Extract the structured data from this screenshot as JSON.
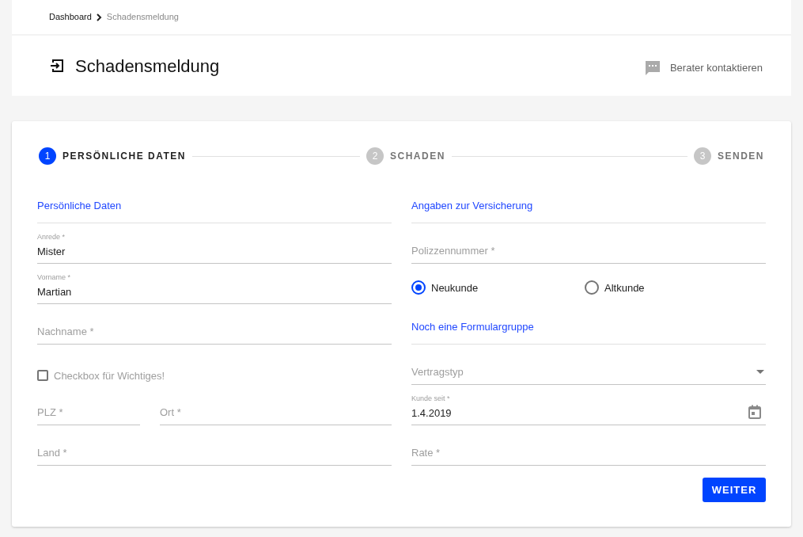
{
  "breadcrumb": [
    {
      "label": "Dashboard",
      "current": false
    },
    {
      "label": "Schadensmeldung",
      "current": true
    }
  ],
  "page_title": "Schadensmeldung",
  "contact_button": "Berater kontaktieren",
  "steps": [
    {
      "number": "1",
      "label": "PERSÖNLICHE DATEN",
      "active": true
    },
    {
      "number": "2",
      "label": "SCHADEN",
      "active": false
    },
    {
      "number": "3",
      "label": "SENDEN",
      "active": false
    }
  ],
  "left_column": [
    {
      "kind": "section",
      "title": "Persönliche Daten"
    },
    {
      "kind": "text",
      "label": "Anrede *",
      "value": "Mister"
    },
    {
      "kind": "text",
      "label": "Vorname *",
      "value": "Martian"
    },
    {
      "kind": "text",
      "placeholder": "Nachname *"
    },
    {
      "kind": "checkbox",
      "label": "Checkbox für Wichtiges!",
      "checked": false
    },
    {
      "kind": "pair",
      "fields": [
        {
          "placeholder": "PLZ *"
        },
        {
          "placeholder": "Ort *"
        }
      ]
    },
    {
      "kind": "text",
      "placeholder": "Land *"
    }
  ],
  "right_column": [
    {
      "kind": "section",
      "title": "Angaben zur Versicherung"
    },
    {
      "kind": "text",
      "placeholder": "Polizzennummer *"
    },
    {
      "kind": "radios",
      "options": [
        {
          "label": "Neukunde",
          "selected": true
        },
        {
          "label": "Altkunde",
          "selected": false
        }
      ]
    },
    {
      "kind": "section",
      "title": "Noch eine Formulargruppe"
    },
    {
      "kind": "select",
      "placeholder": "Vertragstyp"
    },
    {
      "kind": "date",
      "label": "Kunde seit *",
      "value": "1.4.2019"
    },
    {
      "kind": "text",
      "placeholder": "Rate *"
    }
  ],
  "submit_button": "WEITER"
}
